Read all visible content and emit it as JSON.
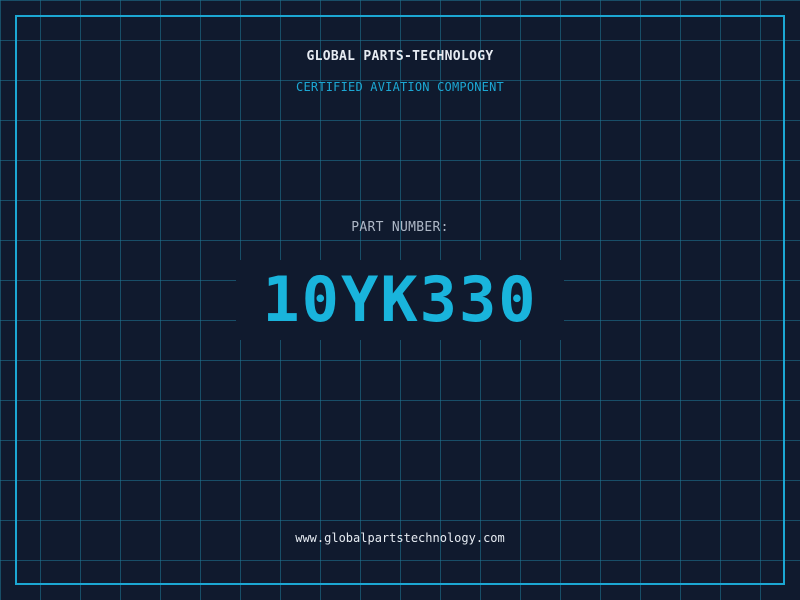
{
  "header": {
    "company": "GLOBAL PARTS-TECHNOLOGY",
    "tagline": "CERTIFIED AVIATION COMPONENT"
  },
  "part": {
    "label": "PART NUMBER:",
    "number": "10YK330"
  },
  "footer": {
    "website": "www.globalpartstechnology.com"
  },
  "colors": {
    "background": "#101a2e",
    "grid": "#207896",
    "accent": "#1ca7d3",
    "part_number": "#19b4dc",
    "text": "#e6ebf2",
    "label": "#aeb7c6"
  }
}
